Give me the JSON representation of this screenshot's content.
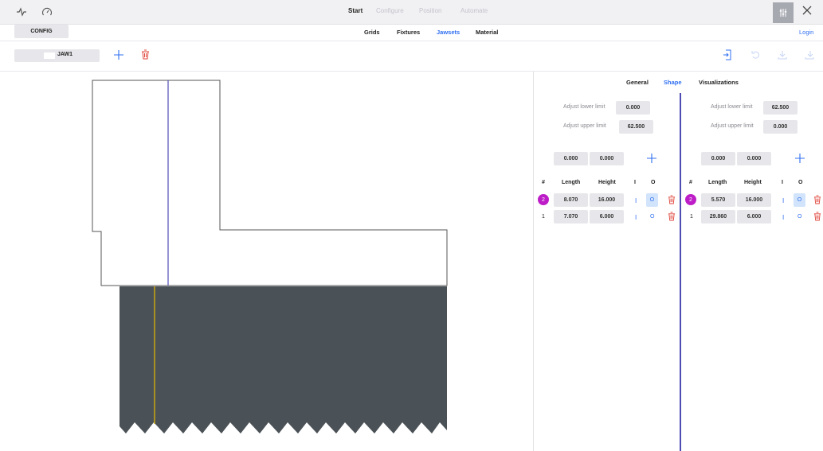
{
  "topbar": {
    "nav": [
      "Start",
      "Configure",
      "Position",
      "Automate"
    ]
  },
  "subbar": {
    "config_label": "CONFIG",
    "tabs": [
      "Grids",
      "Fixtures",
      "Jawsets",
      "Material"
    ],
    "active_tab": "Jawsets",
    "login_label": "Login"
  },
  "toolbar": {
    "jaw_name": "JAW1"
  },
  "panel": {
    "tabs": [
      "General",
      "Shape",
      "Visualizations"
    ],
    "active_tab": "Shape",
    "left": {
      "lower_limit_label": "Adjust lower limit",
      "lower_limit_value": "0.000",
      "upper_limit_label": "Adjust upper limit",
      "upper_limit_value": "62.500",
      "new_length": "0.000",
      "new_height": "0.000",
      "headers": [
        "#",
        "Length",
        "Height",
        "I",
        "O"
      ],
      "rows": [
        {
          "index": "2",
          "length": "8.070",
          "height": "16.000",
          "i": "I",
          "o": "O"
        },
        {
          "index": "1",
          "length": "7.070",
          "height": "6.000",
          "i": "I",
          "o": "O"
        }
      ]
    },
    "right": {
      "lower_limit_label": "Adjust lower limit",
      "lower_limit_value": "62.500",
      "upper_limit_label": "Adjust upper limit",
      "upper_limit_value": "0.000",
      "new_length": "0.000",
      "new_height": "0.000",
      "headers": [
        "#",
        "Length",
        "Height",
        "I",
        "O"
      ],
      "rows": [
        {
          "index": "2",
          "length": "5.570",
          "height": "16.000",
          "i": "I",
          "o": "O"
        },
        {
          "index": "1",
          "length": "29.860",
          "height": "6.000",
          "i": "I",
          "o": "O"
        }
      ]
    }
  },
  "colors": {
    "accent": "#2f6ff0",
    "badge": "#bd1dc7",
    "delete": "#e0453a",
    "material": "#4b5257",
    "axis_line": "#4f4cb4",
    "marker_line": "#e6b800"
  }
}
